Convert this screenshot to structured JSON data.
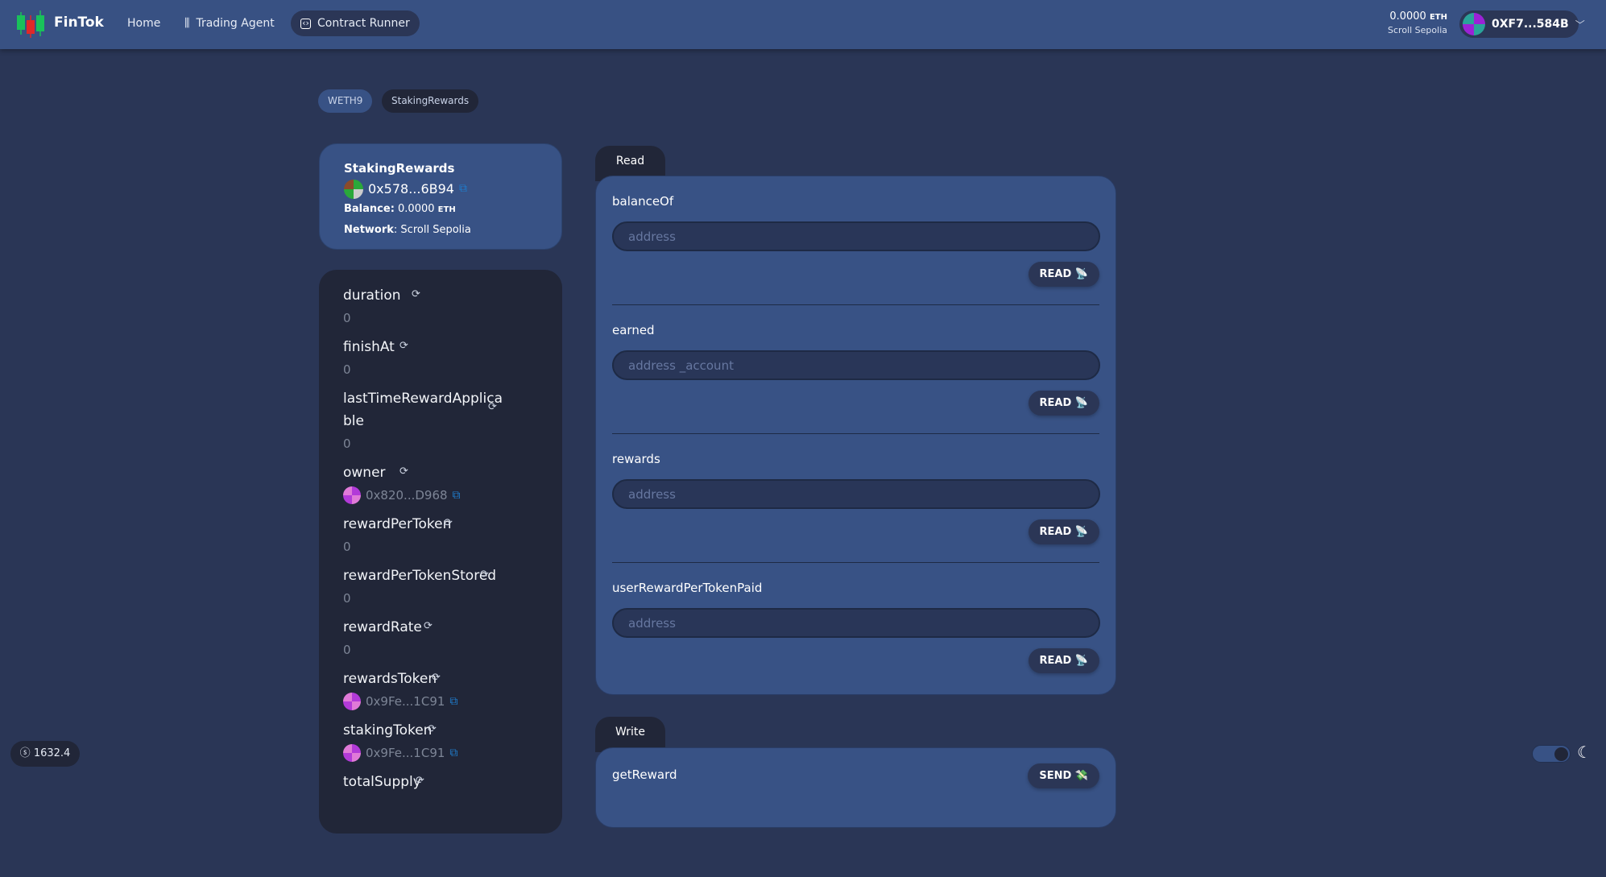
{
  "nav": {
    "brand": "FinTok",
    "links": [
      {
        "label": "Home"
      },
      {
        "label": "Trading Agent",
        "icon": "sliders-icon"
      },
      {
        "label": "Contract Runner",
        "icon": "code-icon",
        "active": true
      }
    ],
    "balance": "0.0000",
    "unit": "ETH",
    "network": "Scroll Sepolia",
    "wallet": "0XF7...584B"
  },
  "contracts": [
    {
      "label": "WETH9"
    },
    {
      "label": "StakingRewards",
      "active": true
    }
  ],
  "info": {
    "name": "StakingRewards",
    "address": "0x578...6B94",
    "balance_label": "Balance:",
    "balance": "0.0000",
    "unit": "ETH",
    "network_label": "Network",
    "network": ": Scroll Sepolia"
  },
  "vars": [
    {
      "name": "duration",
      "value": "0"
    },
    {
      "name": "finishAt",
      "value": "0"
    },
    {
      "name": "lastTimeRewardApplicable",
      "value": "0"
    },
    {
      "name": "owner",
      "value": "0x820...D968",
      "address": true
    },
    {
      "name": "rewardPerToken",
      "value": "0"
    },
    {
      "name": "rewardPerTokenStored",
      "value": "0"
    },
    {
      "name": "rewardRate",
      "value": "0"
    },
    {
      "name": "rewardsToken",
      "value": "0x9Fe...1C91",
      "address": true
    },
    {
      "name": "stakingToken",
      "value": "0x9Fe...1C91",
      "address": true
    },
    {
      "name": "totalSupply",
      "value": ""
    }
  ],
  "read": {
    "tab": "Read",
    "button": "READ 📡",
    "functions": [
      {
        "name": "balanceOf",
        "placeholder": "address"
      },
      {
        "name": "earned",
        "placeholder": "address _account"
      },
      {
        "name": "rewards",
        "placeholder": "address"
      },
      {
        "name": "userRewardPerTokenPaid",
        "placeholder": "address"
      }
    ]
  },
  "write": {
    "tab": "Write",
    "functions": [
      {
        "name": "getReward",
        "button": "SEND 💸"
      }
    ]
  },
  "footer": {
    "price": "1632.4",
    "theme": "dark"
  }
}
